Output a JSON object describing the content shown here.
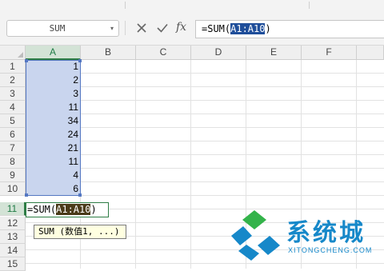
{
  "formula_bar": {
    "name_box": "SUM",
    "fx_label": "fx",
    "formula_prefix": "=SUM(",
    "formula_ref": "A1:A10",
    "formula_suffix": ")"
  },
  "sheet": {
    "columns": [
      "A",
      "B",
      "C",
      "D",
      "E",
      "F"
    ],
    "rows": [
      "1",
      "2",
      "3",
      "4",
      "5",
      "6",
      "7",
      "8",
      "9",
      "10",
      "11",
      "12",
      "13",
      "14",
      "15"
    ],
    "active_column": "A",
    "active_row": "11",
    "values_a": [
      "1",
      "2",
      "3",
      "11",
      "34",
      "24",
      "21",
      "11",
      "4",
      "6"
    ]
  },
  "edit_cell": {
    "prefix": "=SUM(",
    "ref": "A1:A10",
    "suffix": ")"
  },
  "tooltip": {
    "text": "SUM (数值1, ...)"
  },
  "watermark": {
    "name": "系统城",
    "domain": "XITONGCHENG.COM"
  },
  "colors": {
    "selection_fill": "#c9d5ee",
    "selection_border": "#5477c2",
    "active_header_green": "#2e7d45",
    "watermark_blue": "#1688c9",
    "watermark_green": "#33b34a"
  }
}
